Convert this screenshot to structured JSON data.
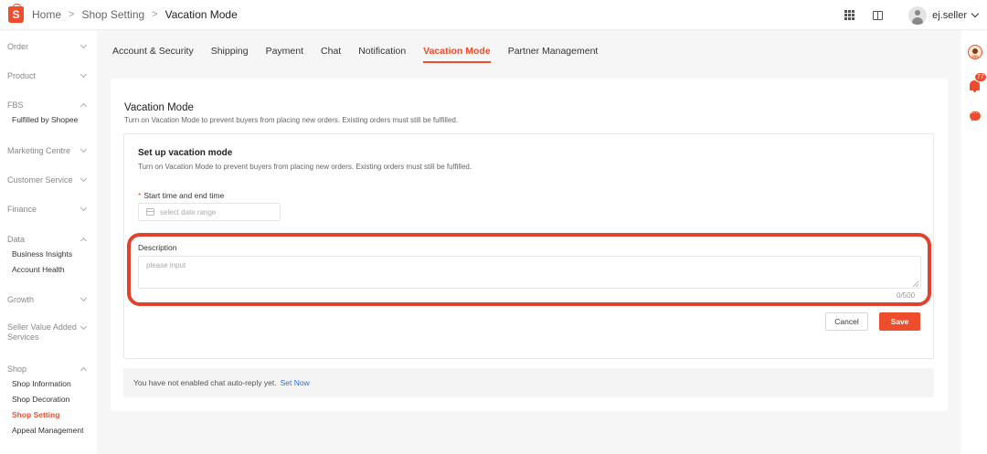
{
  "header": {
    "logo_letter": "S",
    "breadcrumb": [
      "Home",
      "Shop Setting",
      "Vacation Mode"
    ],
    "username": "ej.seller"
  },
  "sidebar": {
    "groups": [
      {
        "label": "Order",
        "expanded": false,
        "items": []
      },
      {
        "label": "Product",
        "expanded": false,
        "items": []
      },
      {
        "label": "FBS",
        "expanded": true,
        "items": [
          "Fulfilled by Shopee"
        ]
      },
      {
        "label": "Marketing Centre",
        "expanded": false,
        "items": []
      },
      {
        "label": "Customer Service",
        "expanded": false,
        "items": []
      },
      {
        "label": "Finance",
        "expanded": false,
        "items": []
      },
      {
        "label": "Data",
        "expanded": true,
        "items": [
          "Business Insights",
          "Account Health"
        ]
      },
      {
        "label": "Growth",
        "expanded": false,
        "items": []
      },
      {
        "label": "Seller Value Added Services",
        "expanded": false,
        "items": []
      },
      {
        "label": "Shop",
        "expanded": true,
        "items": [
          "Shop Information",
          "Shop Decoration",
          "Shop Setting",
          "Appeal Management"
        ],
        "active_item": "Shop Setting"
      }
    ]
  },
  "tabs": [
    {
      "label": "Account & Security",
      "active": false
    },
    {
      "label": "Shipping",
      "active": false
    },
    {
      "label": "Payment",
      "active": false
    },
    {
      "label": "Chat",
      "active": false
    },
    {
      "label": "Notification",
      "active": false
    },
    {
      "label": "Vacation Mode",
      "active": true
    },
    {
      "label": "Partner Management",
      "active": false
    }
  ],
  "main": {
    "title": "Vacation Mode",
    "subtitle": "Turn on Vacation Mode to prevent buyers from placing new orders. Existing orders must still be fulfilled.",
    "panel": {
      "title": "Set up vacation mode",
      "subtitle": "Turn on Vacation Mode to prevent buyers from placing new orders. Existing orders must still be fulfilled.",
      "required_mark": "*",
      "date_label": "Start time and end time",
      "date_placeholder": "select date range",
      "description_label": "Description",
      "description_placeholder": "please input",
      "description_value": "",
      "counter": "0/500",
      "cancel_label": "Cancel",
      "save_label": "Save"
    },
    "notice": {
      "text": "You have not enabled chat auto-reply yet.",
      "link": "Set Now"
    }
  },
  "rail": {
    "notification_count": "77"
  },
  "colors": {
    "accent": "#ee4d2d",
    "link": "#2673dd",
    "highlight_border": "#e0422b"
  }
}
